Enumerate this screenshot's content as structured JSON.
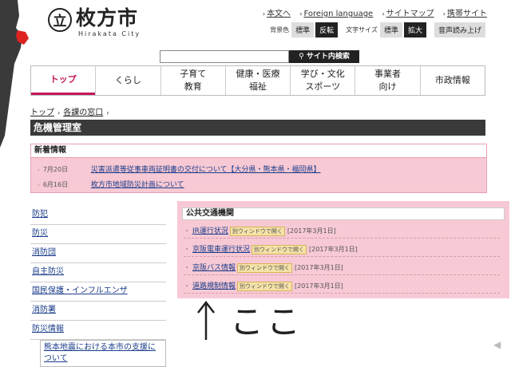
{
  "header": {
    "logo_mark": "立",
    "city_name": "枚方市",
    "city_roman": "Hirakata City",
    "util_links": [
      "本文へ",
      "Foreign language",
      "サイトマップ",
      "携帯サイト"
    ],
    "bg_color_label": "背景色",
    "bg_standard": "標準",
    "bg_reverse": "反転",
    "font_size_label": "文字サイズ",
    "font_standard": "標準",
    "font_large": "拡大",
    "read_aloud": "音声読み上げ"
  },
  "search": {
    "value": "",
    "button_label": "サイト内検索"
  },
  "nav": {
    "items": [
      "トップ",
      "くらし",
      "子育て\n教育",
      "健康・医療\n福祉",
      "学び・文化\nスポーツ",
      "事業者\n向け",
      "市政情報"
    ]
  },
  "breadcrumb": {
    "items": [
      "トップ",
      "各課の窓口"
    ]
  },
  "page_title": "危機管理室",
  "news": {
    "heading": "新着情報",
    "items": [
      {
        "date": "7月20日",
        "text": "災害派遣等従事車両証明書の交付について【大分県・熊本県・福岡県】"
      },
      {
        "date": "6月16日",
        "text": "枚方市地域防災計画について"
      }
    ]
  },
  "left_menu": {
    "items": [
      "防犯",
      "防災",
      "消防団",
      "自主防災",
      "国民保護・インフルエンザ",
      "消防署",
      "防災情報"
    ],
    "sub_item": "熊本地震における本市の支援について"
  },
  "transit": {
    "heading": "公共交通機関",
    "window_label": "別ウィンドウで開く",
    "items": [
      {
        "text": "JR運行状況",
        "date": "[2017年3月1日]"
      },
      {
        "text": "京阪電車運行状況",
        "date": "[2017年3月1日]"
      },
      {
        "text": "京阪バス情報",
        "date": "[2017年3月1日]"
      },
      {
        "text": "道路規制情報",
        "date": "[2017年3月1日]"
      }
    ]
  },
  "annotation": {
    "text": "ここ"
  },
  "colors": {
    "accent": "#c2185b",
    "pink_bg": "#f7c9d4",
    "title_bar": "#3a3a3a"
  }
}
